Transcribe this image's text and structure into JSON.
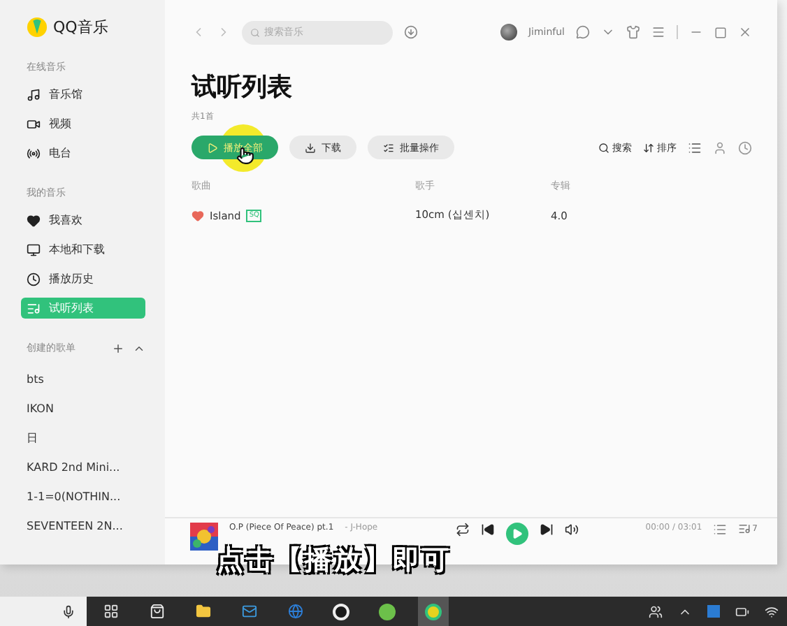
{
  "app": {
    "name": "QQ音乐"
  },
  "sidebar": {
    "sections": [
      {
        "heading": "在线音乐",
        "items": [
          {
            "label": "音乐馆",
            "selected": false
          },
          {
            "label": "视频",
            "selected": false
          },
          {
            "label": "电台",
            "selected": false
          }
        ]
      },
      {
        "heading": "我的音乐",
        "items": [
          {
            "label": "我喜欢",
            "selected": false
          },
          {
            "label": "本地和下载",
            "selected": false
          },
          {
            "label": "播放历史",
            "selected": false
          },
          {
            "label": "试听列表",
            "selected": true
          }
        ]
      }
    ],
    "playlists": {
      "heading": "创建的歌单",
      "items": [
        "bts",
        "IKON",
        "日",
        "KARD 2nd Mini...",
        "1-1=0(NOTHIN...",
        "SEVENTEEN 2N..."
      ]
    }
  },
  "topbar": {
    "search": {
      "placeholder": "搜索音乐"
    },
    "user": "Jiminful"
  },
  "page": {
    "title": "试听列表",
    "count": "共1首",
    "actions": [
      {
        "label": "播放全部",
        "kind": "primary"
      },
      {
        "label": "下载",
        "kind": "secondary"
      },
      {
        "label": "批量操作",
        "kind": "secondary"
      }
    ],
    "tools": [
      "搜索",
      "排序"
    ],
    "columns": [
      "歌曲",
      "歌手",
      "专辑"
    ],
    "rows": [
      {
        "liked": true,
        "title": "Island",
        "badge": "SQ",
        "artist": "10cm (십센치)",
        "album": "4.0"
      }
    ]
  },
  "player": {
    "title": "O.P (Piece Of Peace) pt.1",
    "artist": "- J-Hope",
    "time": "00:00 / 03:01",
    "queue_count": "7"
  },
  "caption": "点击【播放】即可"
}
